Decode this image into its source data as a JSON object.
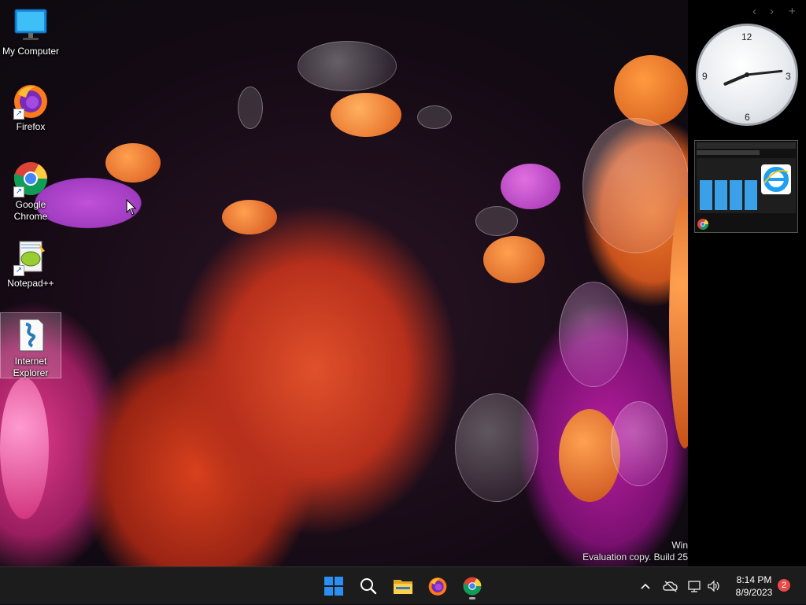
{
  "desktop": {
    "icons": [
      {
        "label": "My Computer"
      },
      {
        "label": "Firefox"
      },
      {
        "label": "Google Chrome"
      },
      {
        "label": "Notepad++"
      },
      {
        "label": "Internet Explorer"
      }
    ]
  },
  "watermark": {
    "line1": "Win",
    "line2": "Evaluation copy. Build 25"
  },
  "side_panel": {
    "nav_prev": "‹",
    "nav_next": "›",
    "add": "+",
    "clock": {
      "n12": "12",
      "n3": "3",
      "n6": "6",
      "n9": "9",
      "hour": 8,
      "minute": 14
    }
  },
  "taskbar": {
    "time": "8:14 PM",
    "date": "8/9/2023",
    "notification_count": "2",
    "tray_chevron": "^"
  },
  "colors": {
    "taskbar_bg": "#1c1c1c",
    "windows_blue": "#2a8ff0",
    "badge_red": "#e84a4a"
  }
}
